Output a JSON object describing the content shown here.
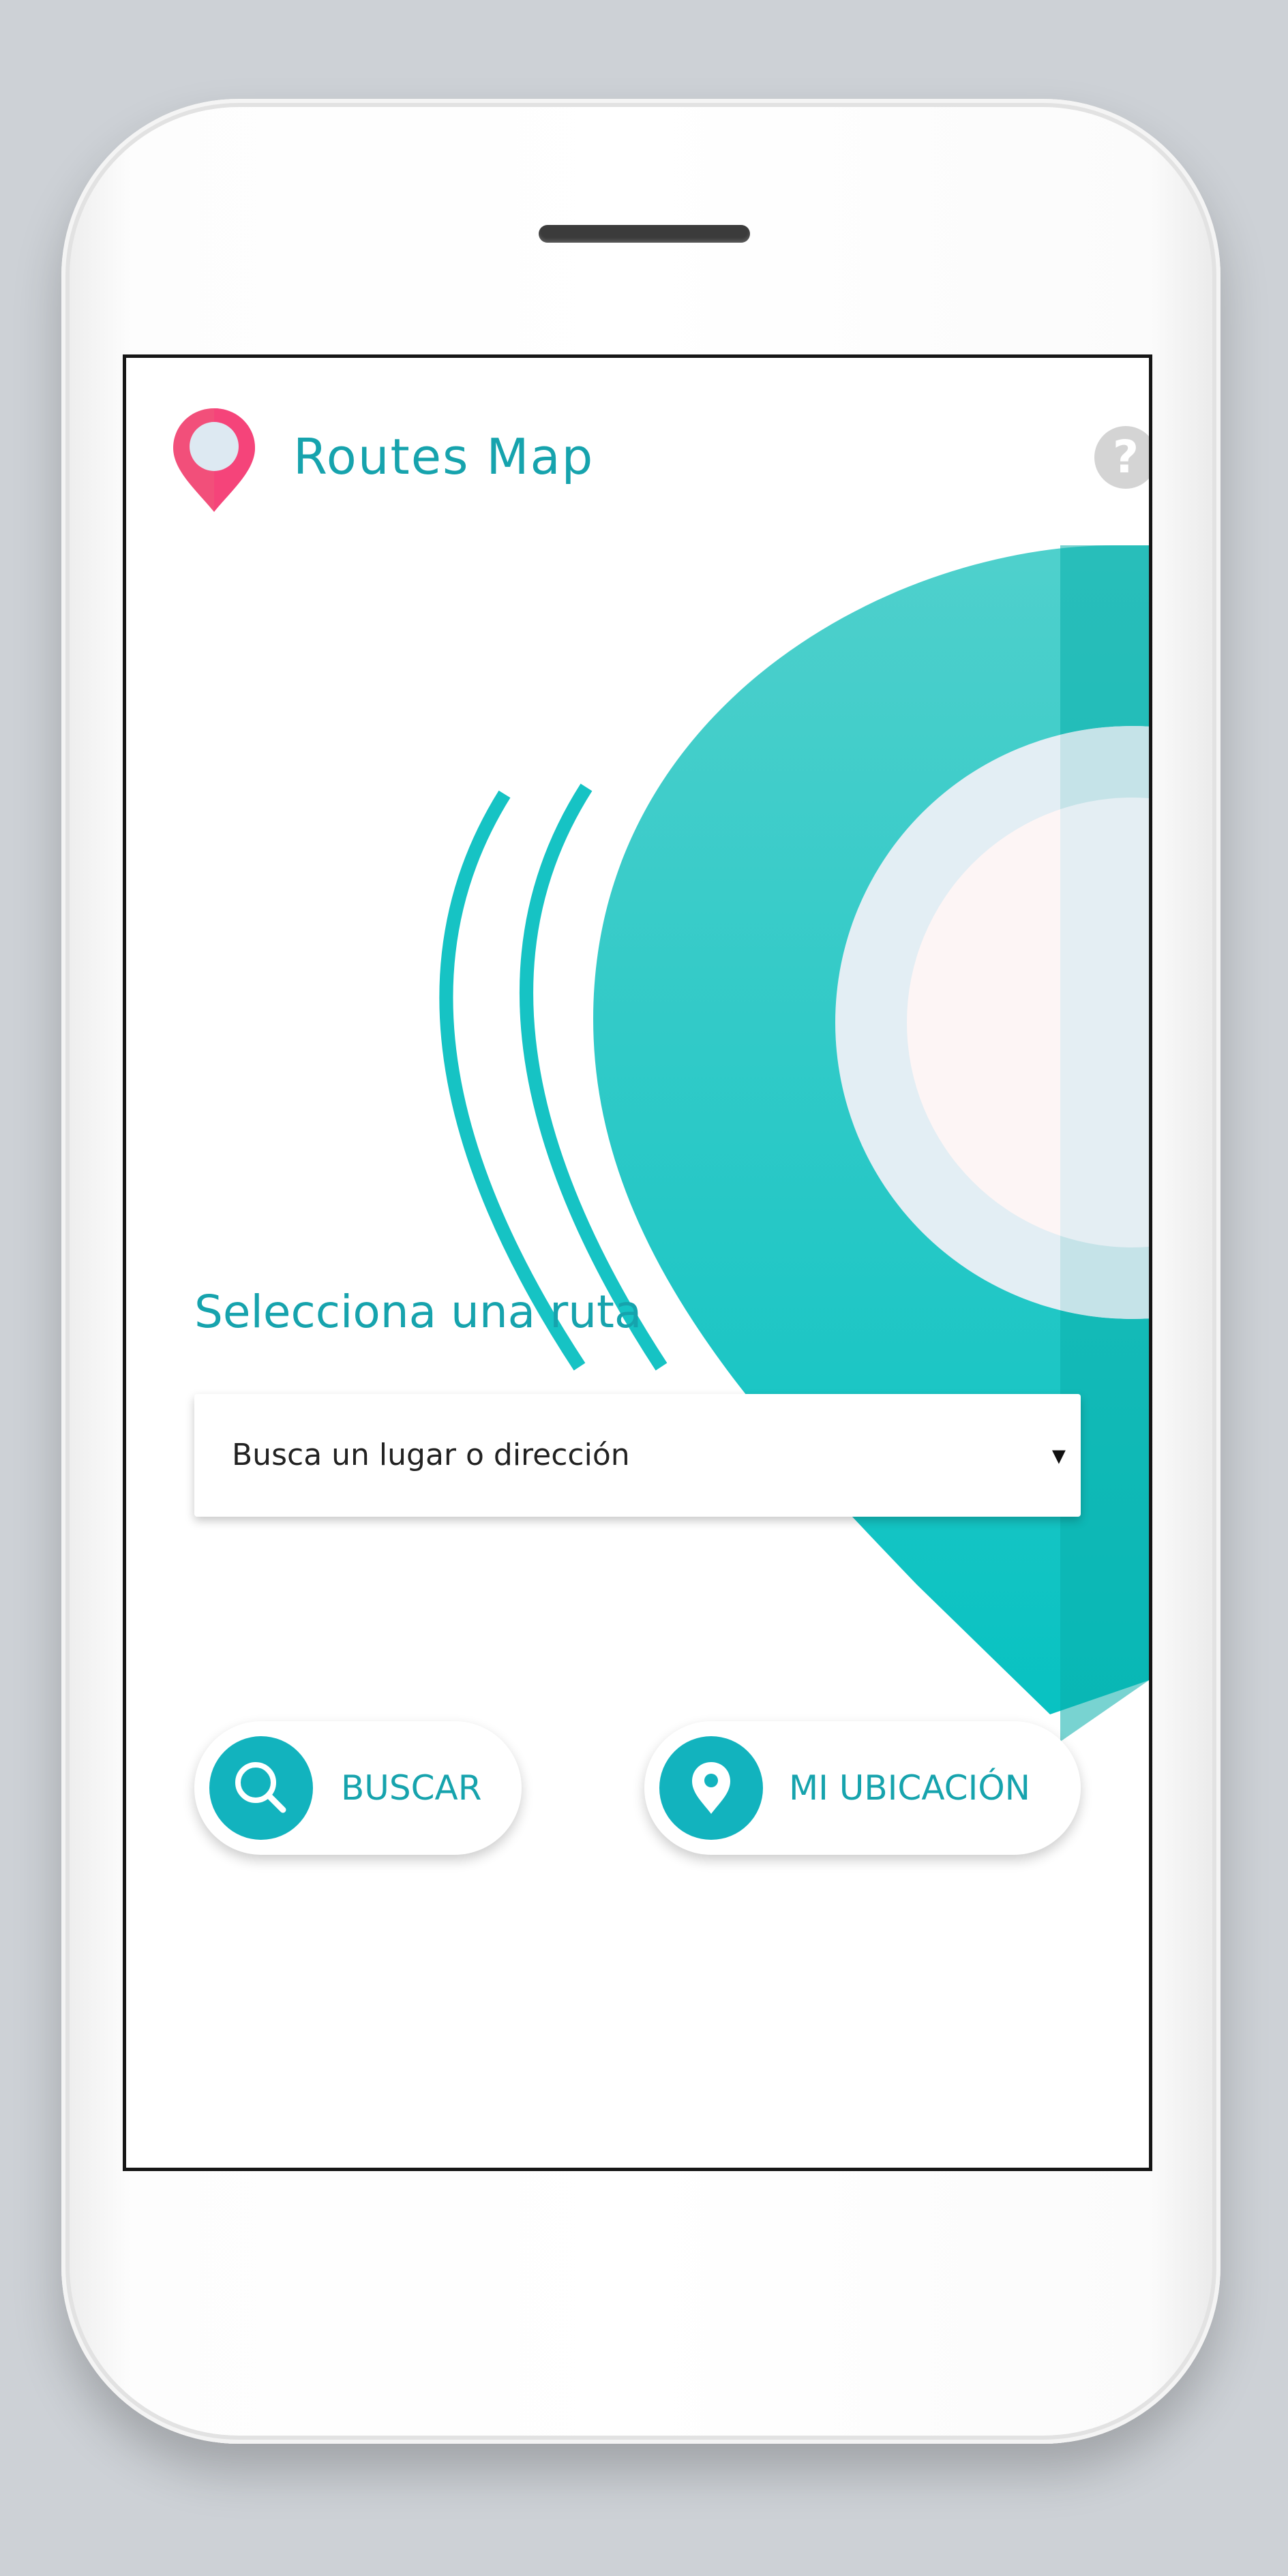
{
  "header": {
    "app_title": "Routes Map",
    "help_label": "?"
  },
  "main": {
    "section_title": "Selecciona una ruta",
    "select": {
      "placeholder": "Busca un lugar o dirección",
      "arrow": "▾"
    },
    "buttons": {
      "search_label": "BUSCAR",
      "location_label": "MI UBICACIÓN"
    }
  },
  "icons": {
    "logo": "map-pin-icon",
    "help": "help-icon",
    "search": "search-icon",
    "location": "location-pin-icon"
  },
  "colors": {
    "accent": "#16a3ad",
    "teal": "#12b3be",
    "logo_pink": "#f24f7a",
    "help_gray": "#d4d4d4"
  }
}
